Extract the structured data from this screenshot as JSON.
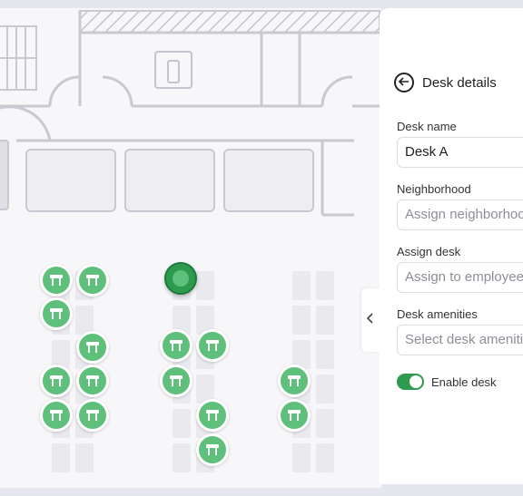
{
  "panel": {
    "title": "Desk details",
    "fields": {
      "desk_name": {
        "label": "Desk name",
        "value": "Desk A"
      },
      "neighborhood": {
        "label": "Neighborhood",
        "placeholder": "Assign neighborhood"
      },
      "assign_desk": {
        "label": "Assign desk",
        "placeholder": "Assign to employee"
      },
      "amenities": {
        "label": "Desk amenities",
        "placeholder": "Select desk amenities"
      }
    },
    "enable_desk": {
      "label": "Enable desk",
      "enabled": true
    }
  },
  "map": {
    "desk_marker_icon": "desk-icon",
    "selected_marker": "selected-desk-marker",
    "info_icon": "info-icon"
  },
  "colors": {
    "accent": "#2e9a4e",
    "marker": "#5fc07c",
    "wall": "#c9cad1",
    "background": "#e6e7ee"
  }
}
